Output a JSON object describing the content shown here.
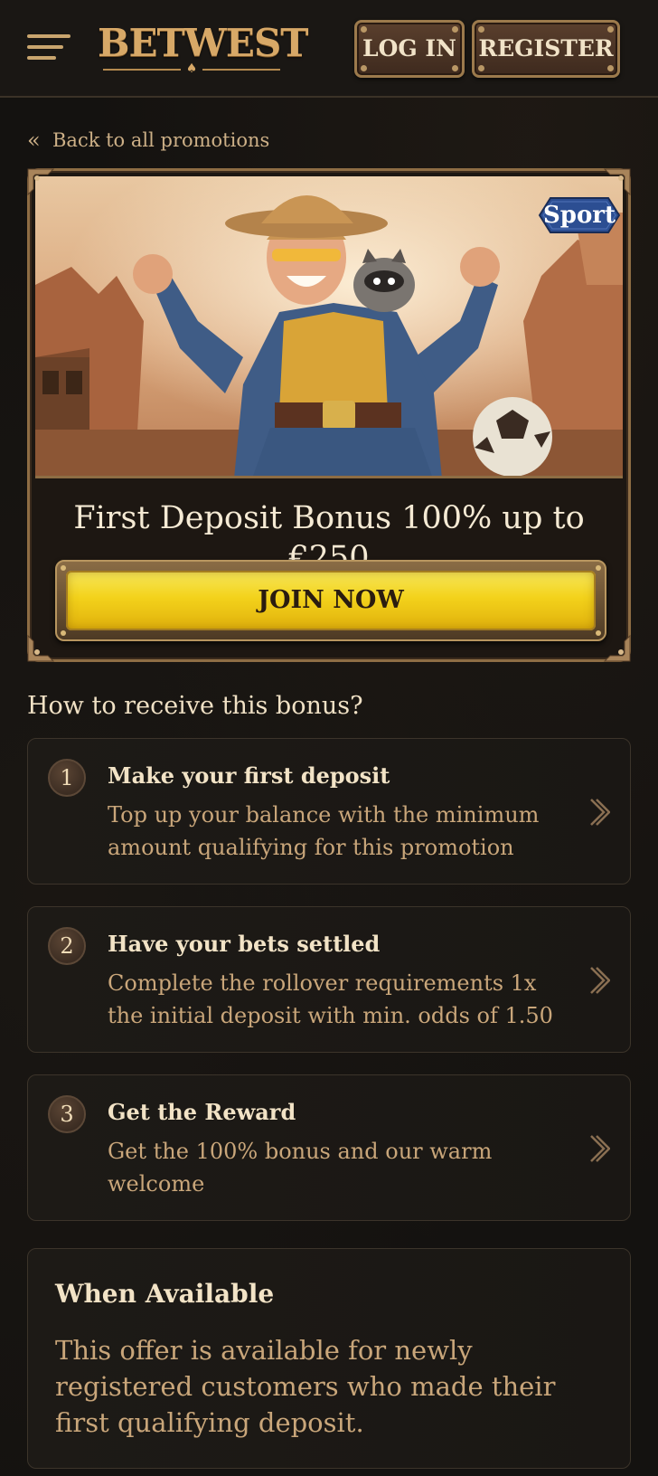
{
  "header": {
    "logo_text": "BETWEST",
    "login_label": "LOG IN",
    "register_label": "REGISTER"
  },
  "back_link": {
    "label": "Back to all promotions"
  },
  "promo": {
    "badge": "Sport",
    "title": "First Deposit Bonus 100% up to €250",
    "cta_label": "JOIN NOW"
  },
  "how_to": {
    "title": "How to receive this bonus?",
    "steps": [
      {
        "number": "1",
        "title": "Make your first deposit",
        "description": "Top up your balance with the minimum amount qualifying for this promotion"
      },
      {
        "number": "2",
        "title": "Have your bets settled",
        "description": "Complete the rollover requirements 1x the initial deposit with min. odds of 1.50"
      },
      {
        "number": "3",
        "title": "Get the Reward",
        "description": "Get the 100% bonus and our warm welcome"
      }
    ]
  },
  "availability": {
    "title": "When Available",
    "text": "This offer is available for newly registered customers who made their first qualifying deposit."
  },
  "colors": {
    "background": "#141210",
    "accent_gold": "#d7a867",
    "cta_yellow": "#f3d21b",
    "badge_blue": "#2c4e92",
    "text_muted": "#c9a67a"
  }
}
